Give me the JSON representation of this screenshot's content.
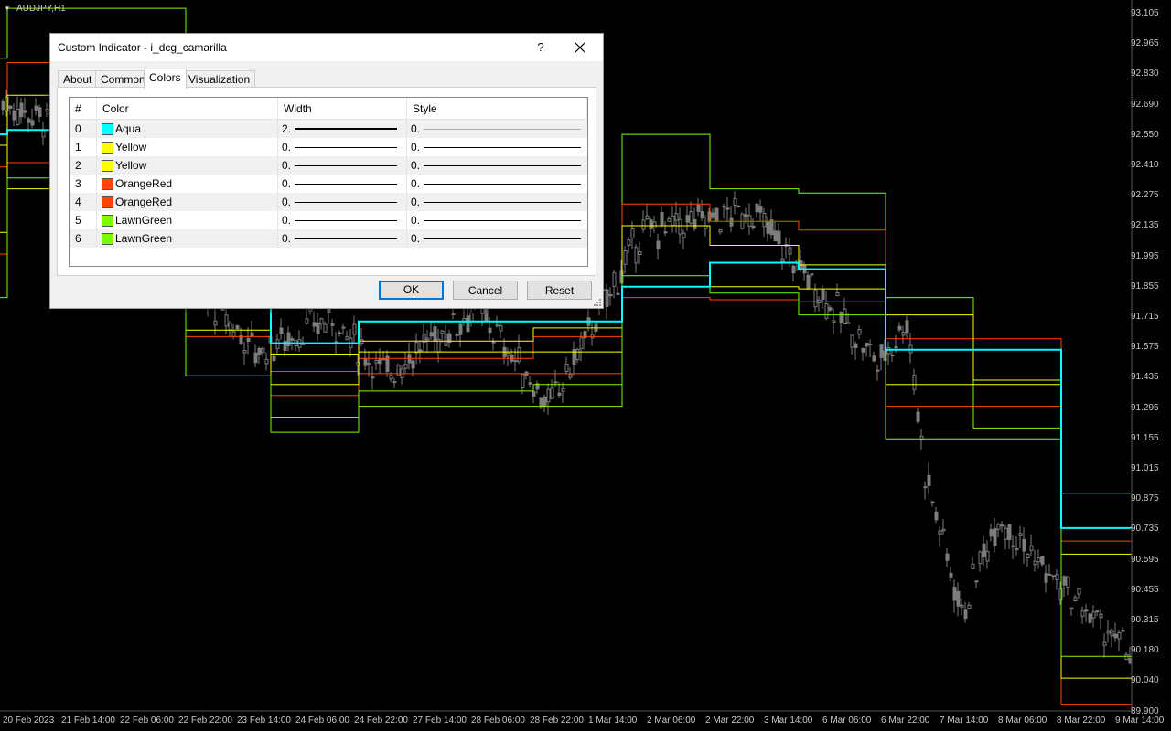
{
  "chart": {
    "symbol": "AUDJPY,H1",
    "price_labels": [
      "93.105",
      "92.965",
      "92.830",
      "92.690",
      "92.550",
      "92.410",
      "92.275",
      "92.135",
      "91.995",
      "91.855",
      "91.715",
      "91.575",
      "91.435",
      "91.295",
      "91.155",
      "91.015",
      "90.875",
      "90.735",
      "90.595",
      "90.455",
      "90.315",
      "90.180",
      "90.040",
      "89.900"
    ],
    "time_labels": [
      "20 Feb 2023",
      "21 Feb 14:00",
      "22 Feb 06:00",
      "22 Feb 22:00",
      "23 Feb 14:00",
      "24 Feb 06:00",
      "24 Feb 22:00",
      "27 Feb 14:00",
      "28 Feb 06:00",
      "28 Feb 22:00",
      "1 Mar 14:00",
      "2 Mar 06:00",
      "2 Mar 22:00",
      "3 Mar 14:00",
      "6 Mar 06:00",
      "6 Mar 22:00",
      "7 Mar 14:00",
      "8 Mar 06:00",
      "8 Mar 22:00",
      "9 Mar 14:00"
    ],
    "colors": {
      "background": "#000000",
      "candle": "#7d7d7d",
      "aqua": "#00ffff",
      "yellow": "#ffff00",
      "orangered": "#ff4500",
      "lawngreen": "#7cfc00"
    }
  },
  "dialog": {
    "title": "Custom Indicator - i_dcg_camarilla",
    "help_label": "?",
    "tabs": [
      {
        "label": "About",
        "active": false
      },
      {
        "label": "Common",
        "active": false
      },
      {
        "label": "Colors",
        "active": true
      },
      {
        "label": "Visualization",
        "active": false
      }
    ],
    "columns": {
      "index": "#",
      "color": "Color",
      "width": "Width",
      "style": "Style"
    },
    "rows": [
      {
        "index": "0",
        "color_name": "Aqua",
        "hex": "#00ffff",
        "width": "2.",
        "style": "0."
      },
      {
        "index": "1",
        "color_name": "Yellow",
        "hex": "#ffff00",
        "width": "0.",
        "style": "0."
      },
      {
        "index": "2",
        "color_name": "Yellow",
        "hex": "#ffff00",
        "width": "0.",
        "style": "0."
      },
      {
        "index": "3",
        "color_name": "OrangeRed",
        "hex": "#ff4500",
        "width": "0.",
        "style": "0."
      },
      {
        "index": "4",
        "color_name": "OrangeRed",
        "hex": "#ff4500",
        "width": "0.",
        "style": "0."
      },
      {
        "index": "5",
        "color_name": "LawnGreen",
        "hex": "#7cfc00",
        "width": "0.",
        "style": "0."
      },
      {
        "index": "6",
        "color_name": "LawnGreen",
        "hex": "#7cfc00",
        "width": "0.",
        "style": "0."
      }
    ],
    "buttons": {
      "ok": "OK",
      "cancel": "Cancel",
      "reset": "Reset"
    }
  }
}
